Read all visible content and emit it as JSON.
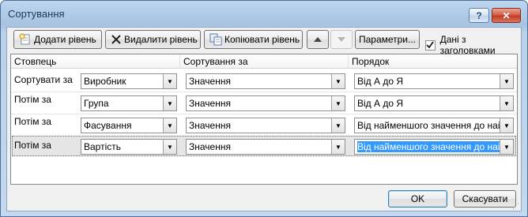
{
  "window": {
    "title": "Сортування"
  },
  "titlebar": {
    "help_label": "?",
    "close_label": "✕"
  },
  "toolbar": {
    "add_level": "Додати рівень",
    "delete_level": "Видалити рівень",
    "copy_level": "Копіювати рівень",
    "move_up_icon": "up-arrow-icon",
    "move_down_icon": "down-arrow-icon",
    "parameters": "Параметри...",
    "headers_checkbox_label": "Дані з заголовками",
    "headers_checked": true
  },
  "grid": {
    "headers": [
      "Стовпець",
      "Сортування за",
      "Порядок"
    ],
    "rows": [
      {
        "label": "Сортувати за",
        "column": "Виробник",
        "sort_on": "Значення",
        "order": "Від А до Я"
      },
      {
        "label": "Потім за",
        "column": "Група",
        "sort_on": "Значення",
        "order": "Від А до Я"
      },
      {
        "label": "Потім за",
        "column": "Фасування",
        "sort_on": "Значення",
        "order": "Від найменшого значення до найбіл"
      },
      {
        "label": "Потім за",
        "column": "Вартість",
        "sort_on": "Значення",
        "order": "Від найменшого значення до найбіл"
      }
    ],
    "selected_row": 3
  },
  "footer": {
    "ok": "OK",
    "cancel": "Скасувати"
  },
  "colors": {
    "title_text": "#1e395b",
    "selection": "#3399ff",
    "close_button": "#c0381f"
  }
}
